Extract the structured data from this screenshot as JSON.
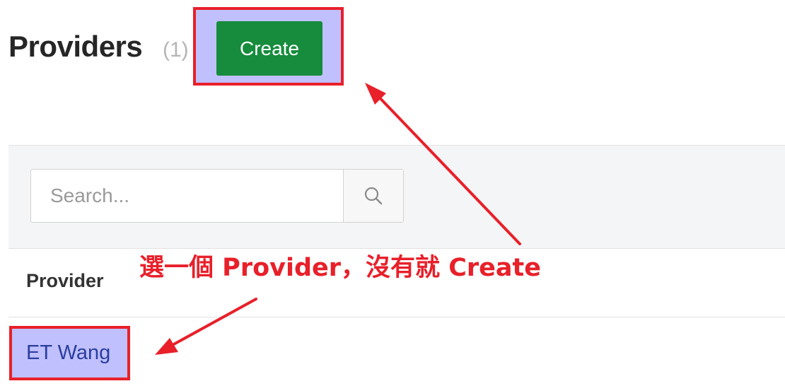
{
  "header": {
    "title": "Providers",
    "count": "(1)",
    "create_label": "Create"
  },
  "search": {
    "placeholder": "Search...",
    "value": "",
    "button_icon": "search-icon"
  },
  "table": {
    "columns": [
      "Provider"
    ],
    "rows": [
      {
        "provider": "ET Wang"
      }
    ]
  },
  "annotation": {
    "text": "選一個 Provider，沒有就 Create",
    "color": "#e8202a",
    "highlight_fill": "#c0c0ff"
  },
  "colors": {
    "create_button": "#168c3c",
    "link": "#2a3e9e"
  }
}
